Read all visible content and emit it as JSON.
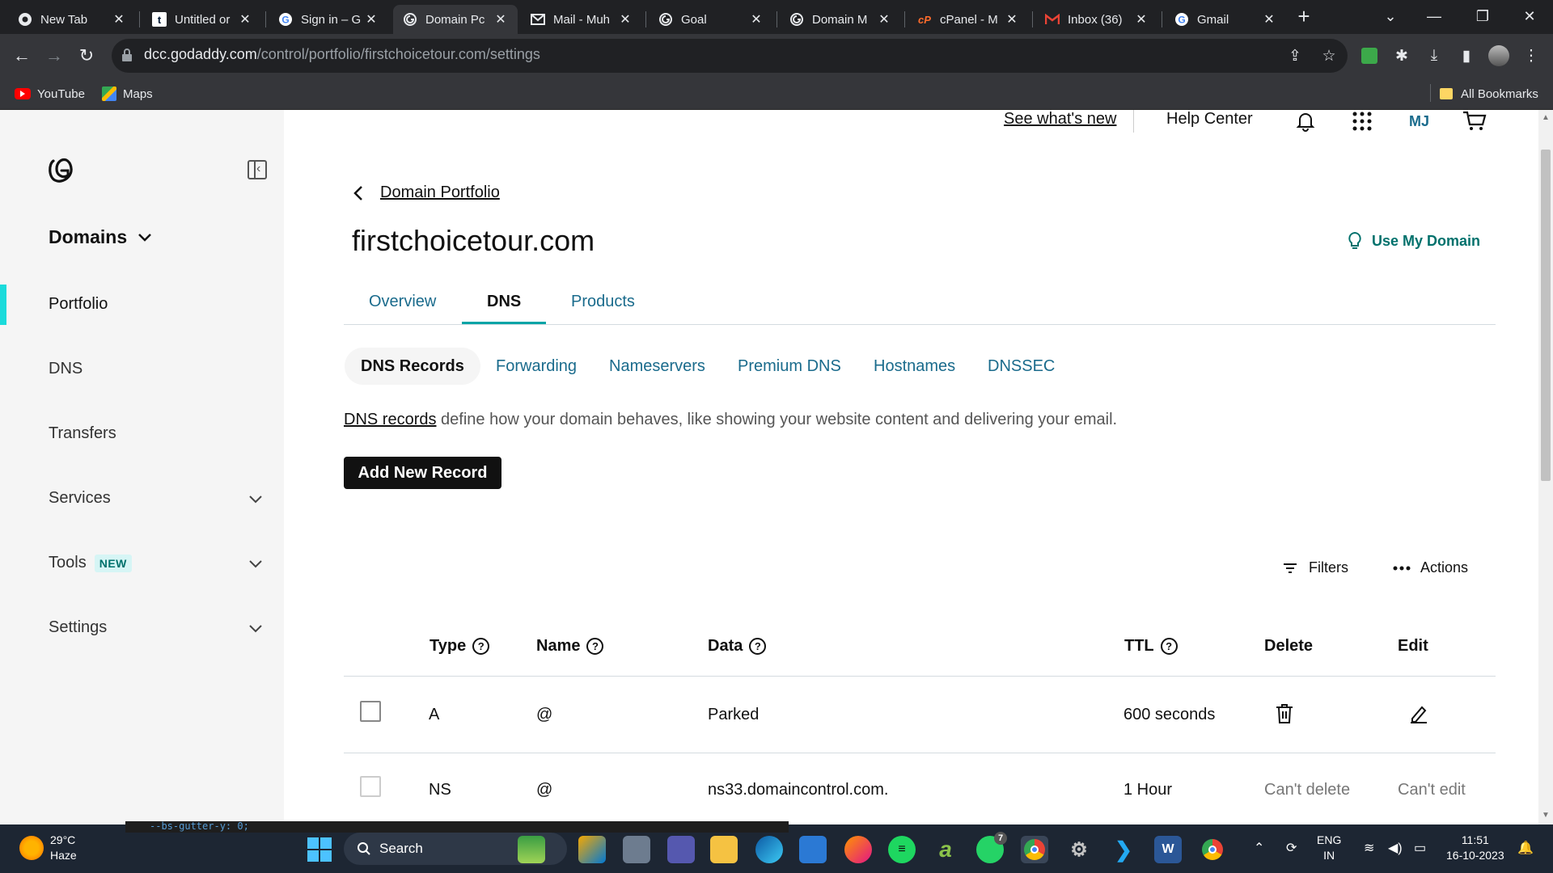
{
  "browser": {
    "tabs": [
      {
        "label": "New Tab",
        "icon": "chrome-icon",
        "color": "#e8eaed"
      },
      {
        "label": "Untitled or",
        "icon": "tumblr-icon",
        "color": "#e8eaed"
      },
      {
        "label": "Sign in – G",
        "icon": "google-icon",
        "color": "#e8eaed"
      },
      {
        "label": "Domain Pc",
        "icon": "godaddy-icon",
        "color": "#e8eaed"
      },
      {
        "label": "Mail - Muh",
        "icon": "mail-icon",
        "color": "#e8eaed"
      },
      {
        "label": "Goal",
        "icon": "godaddy-icon",
        "color": "#e8eaed"
      },
      {
        "label": "Domain M",
        "icon": "godaddy-icon",
        "color": "#e8eaed"
      },
      {
        "label": "cPanel - M",
        "icon": "cpanel-icon",
        "color": "#ff6c2c"
      },
      {
        "label": "Inbox (36)",
        "icon": "gmail-icon",
        "color": "#e8eaed"
      },
      {
        "label": "Gmail",
        "icon": "google-icon",
        "color": "#e8eaed"
      }
    ],
    "url_host": "dcc.godaddy.com",
    "url_path": "/control/portfolio/firstchoicetour.com/settings",
    "bookmarks": {
      "youtube": "YouTube",
      "maps": "Maps",
      "all": "All Bookmarks"
    }
  },
  "header": {
    "whats_new": "See what's new",
    "help_center": "Help Center",
    "avatar_initials": "MJ"
  },
  "sidebar": {
    "title": "Domains",
    "items": [
      {
        "label": "Portfolio"
      },
      {
        "label": "DNS"
      },
      {
        "label": "Transfers"
      },
      {
        "label": "Services"
      },
      {
        "label": "Tools"
      },
      {
        "label": "Settings"
      }
    ],
    "tools_badge": "NEW"
  },
  "main": {
    "back_label": "Domain Portfolio",
    "domain": "firstchoicetour.com",
    "use_domain": "Use My Domain",
    "tabs": [
      {
        "label": "Overview"
      },
      {
        "label": "DNS"
      },
      {
        "label": "Products"
      }
    ],
    "subtabs": [
      {
        "label": "DNS Records"
      },
      {
        "label": "Forwarding"
      },
      {
        "label": "Nameservers"
      },
      {
        "label": "Premium DNS"
      },
      {
        "label": "Hostnames"
      },
      {
        "label": "DNSSEC"
      }
    ],
    "desc_link": "DNS records",
    "desc_text": " define how your domain behaves, like showing your website content and delivering your email.",
    "add_button": "Add New Record",
    "filters": "Filters",
    "actions": "Actions",
    "columns": {
      "type": "Type",
      "name": "Name",
      "data": "Data",
      "ttl": "TTL",
      "delete": "Delete",
      "edit": "Edit"
    },
    "records": [
      {
        "type": "A",
        "name": "@",
        "data": "Parked",
        "ttl": "600 seconds",
        "delete": "",
        "edit": ""
      },
      {
        "type": "NS",
        "name": "@",
        "data": "ns33.domaincontrol.com.",
        "ttl": "1 Hour",
        "delete": "Can't delete",
        "edit": "Can't edit"
      }
    ]
  },
  "devstrip": "--bs-gutter-y: 0;",
  "taskbar": {
    "temp": "29°C",
    "weather": "Haze",
    "search": "Search",
    "lang_1": "ENG",
    "lang_2": "IN",
    "time": "11:51",
    "date": "16-10-2023",
    "whatsapp_badge": "7"
  },
  "colors": {
    "accent": "#00a4a6",
    "link": "#1a6b8c",
    "brand_green": "#00716c",
    "active_indicator": "#1bdbdb"
  }
}
